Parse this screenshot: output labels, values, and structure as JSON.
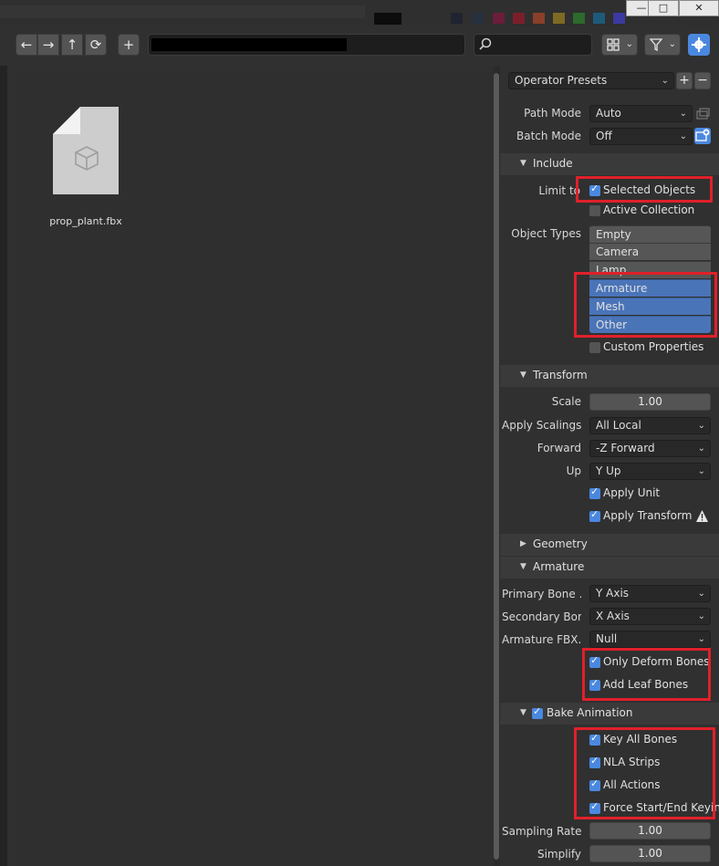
{
  "window": {
    "minimize": "—",
    "maximize": "□",
    "close": "✕"
  },
  "toolbar": {
    "back_icon": "←",
    "forward_icon": "→",
    "parent_icon": "↑",
    "refresh_icon": "⟳",
    "new_folder_icon": "+"
  },
  "colors": {
    "accent": "#4a88e0",
    "selected": "#4a74b8",
    "highlight": "#e0202a"
  },
  "file": {
    "name": "prop_plant.fbx"
  },
  "presets": {
    "label": "Operator Presets",
    "add": "+",
    "remove": "−"
  },
  "path": {
    "path_mode_label": "Path Mode",
    "path_mode_value": "Auto",
    "batch_mode_label": "Batch Mode",
    "batch_mode_value": "Off"
  },
  "include": {
    "title": "Include",
    "limit_label": "Limit to",
    "selected_objects": "Selected Objects",
    "active_collection": "Active Collection",
    "object_types_label": "Object Types",
    "types": [
      "Empty",
      "Camera",
      "Lamp",
      "Armature",
      "Mesh",
      "Other"
    ],
    "custom_properties": "Custom Properties"
  },
  "transform": {
    "title": "Transform",
    "scale_label": "Scale",
    "scale_value": "1.00",
    "apply_scalings_label": "Apply Scalings",
    "apply_scalings_value": "All Local",
    "forward_label": "Forward",
    "forward_value": "-Z Forward",
    "up_label": "Up",
    "up_value": "Y Up",
    "apply_unit": "Apply Unit",
    "apply_transform": "Apply Transform"
  },
  "geometry": {
    "title": "Geometry"
  },
  "armature": {
    "title": "Armature",
    "primary_label": "Primary Bone ...",
    "primary_value": "Y Axis",
    "secondary_label": "Secondary Bon...",
    "secondary_value": "X Axis",
    "fbx_label": "Armature FBX...",
    "fbx_value": "Null",
    "only_deform": "Only Deform Bones",
    "add_leaf": "Add Leaf Bones"
  },
  "bake": {
    "title": "Bake Animation",
    "key_all": "Key All Bones",
    "nla": "NLA Strips",
    "all_actions": "All Actions",
    "force_keying": "Force Start/End Keying",
    "sampling_label": "Sampling Rate",
    "sampling_value": "1.00",
    "simplify_label": "Simplify",
    "simplify_value": "1.00"
  }
}
